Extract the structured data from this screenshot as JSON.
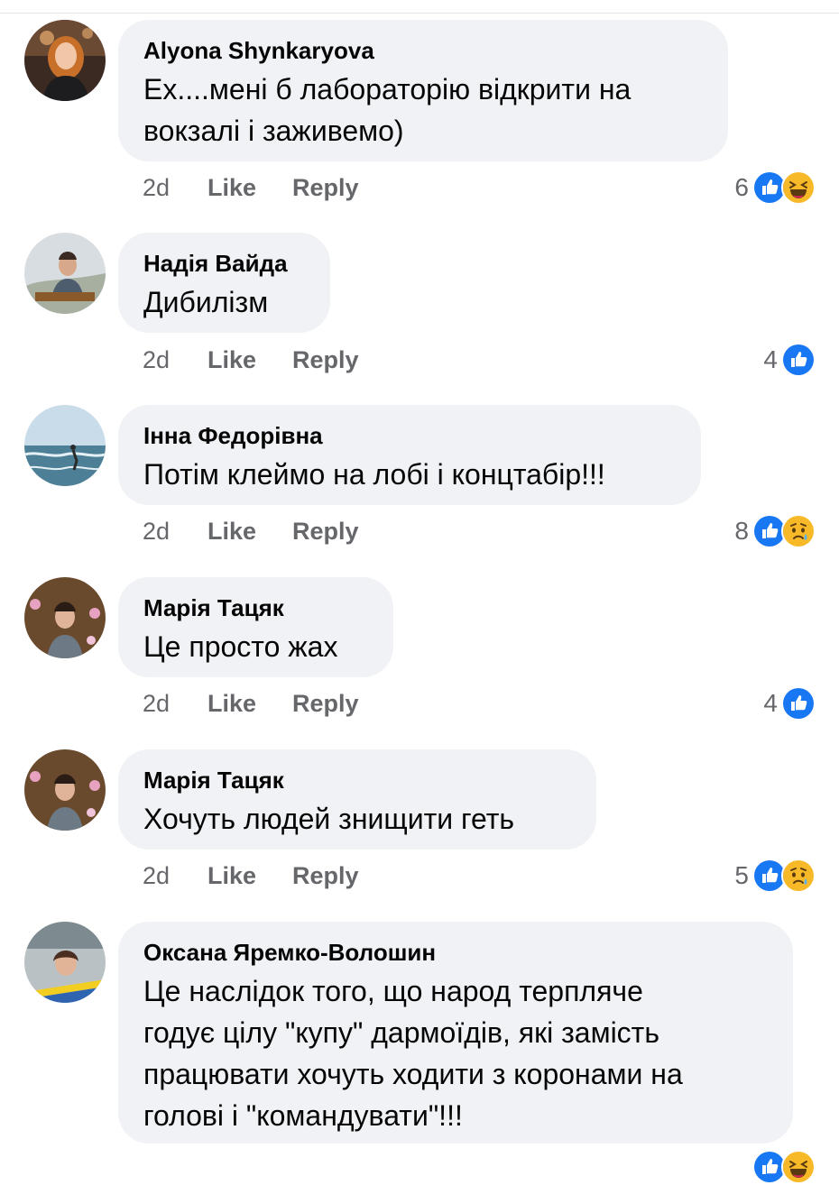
{
  "comments": [
    {
      "author": "Alyona Shynkaryova",
      "text": "Ex....мені б лабораторію відкрити на\nвокзалі і заживемо)",
      "time": "2d",
      "like": "Like",
      "reply": "Reply",
      "reaction_count": "6",
      "reactions": [
        "like-icon",
        "haha-icon"
      ]
    },
    {
      "author": "Надія Вайда",
      "text": "Дибилізм",
      "time": "2d",
      "like": "Like",
      "reply": "Reply",
      "reaction_count": "4",
      "reactions": [
        "like-icon"
      ]
    },
    {
      "author": "Інна Федорівна",
      "text": "Потім клеймо на лобі і концтабір!!!",
      "time": "2d",
      "like": "Like",
      "reply": "Reply",
      "reaction_count": "8",
      "reactions": [
        "like-icon",
        "sad-icon"
      ]
    },
    {
      "author": "Марія Тацяк",
      "text": "Це просто жах",
      "time": "2d",
      "like": "Like",
      "reply": "Reply",
      "reaction_count": "4",
      "reactions": [
        "like-icon"
      ]
    },
    {
      "author": "Марія Тацяк",
      "text": "Хочуть людей знищити геть",
      "time": "2d",
      "like": "Like",
      "reply": "Reply",
      "reaction_count": "5",
      "reactions": [
        "like-icon",
        "sad-icon"
      ]
    },
    {
      "author": "Оксана Яремко-Волошин",
      "text": "Це наслідок того, що народ терпляче\nгодує цілу \"купу\" дармоїдів, які замість\nпрацювати хочуть ходити з коронами на\nголові і \"командувати\"!!!",
      "reactions": [
        "like-icon",
        "haha-icon"
      ]
    }
  ],
  "colors": {
    "like_blue": "#1877f2",
    "emoji_yellow": "#f7b928",
    "bubble_bg": "#f0f2f5",
    "meta_gray": "#65676b"
  }
}
